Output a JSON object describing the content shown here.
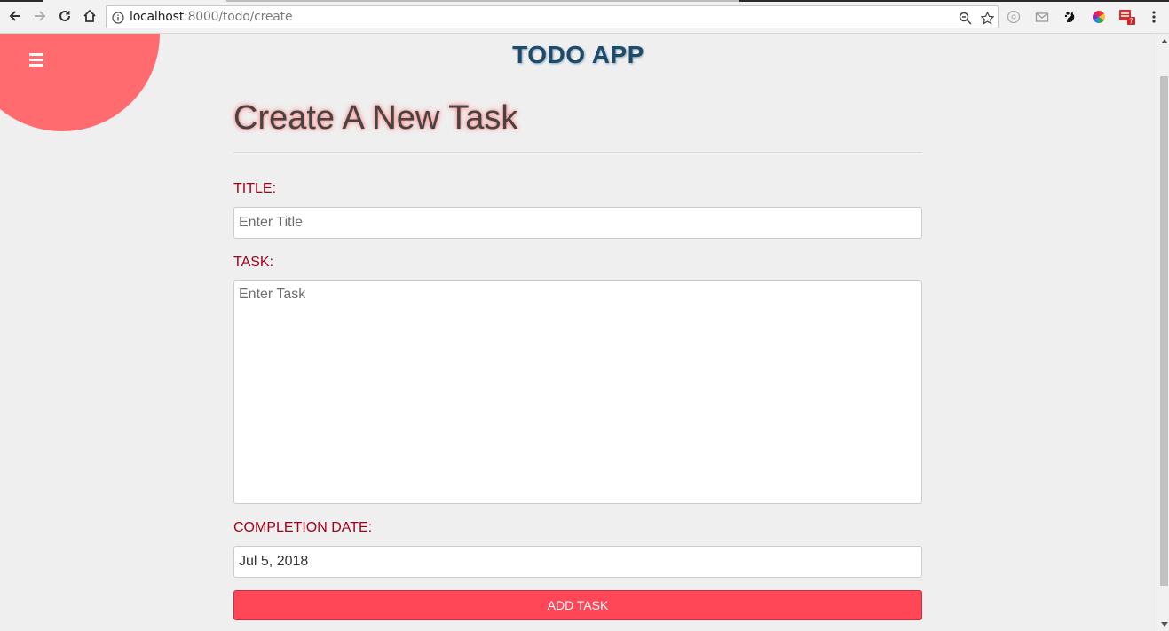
{
  "browser": {
    "url_host": "localhost",
    "url_path": ":8000/todo/create"
  },
  "app": {
    "title": "TODO APP"
  },
  "form": {
    "heading": "Create A New Task",
    "title_label": "TITLE:",
    "title_placeholder": "Enter Title",
    "task_label": "TASK:",
    "task_placeholder": "Enter Task",
    "date_label": "COMPLETION DATE:",
    "date_value": "Jul 5, 2018",
    "submit_label": "ADD TASK"
  },
  "colors": {
    "accent": "#ff4757",
    "menu_blob": "#ff6b6f",
    "label": "#a3001a",
    "app_title": "#1f4b6b"
  }
}
